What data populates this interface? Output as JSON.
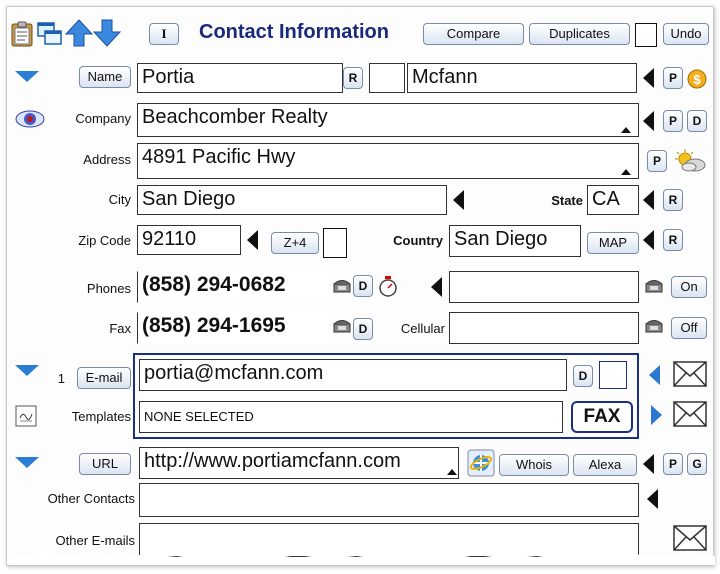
{
  "header": {
    "title": "Contact Information",
    "i_label": "I",
    "compare_label": "Compare",
    "duplicates_label": "Duplicates",
    "undo_label": "Undo"
  },
  "name": {
    "button_label": "Name",
    "first": "Portia",
    "r_label": "R",
    "middle": "",
    "last": "Mcfann",
    "p_label": "P"
  },
  "company": {
    "label": "Company",
    "value": "Beachcomber Realty",
    "p_label": "P",
    "d_label": "D"
  },
  "address": {
    "label": "Address",
    "value": "4891 Pacific Hwy",
    "p_label": "P"
  },
  "city": {
    "label": "City",
    "value": "San Diego",
    "state_label": "State",
    "state_value": "CA",
    "r_label": "R"
  },
  "zip": {
    "label": "Zip Code",
    "value": "92110",
    "z4_label": "Z+4",
    "country_label": "Country",
    "country_value": "San Diego",
    "map_label": "MAP",
    "r_label": "R"
  },
  "phones": {
    "label": "Phones",
    "value": "(858) 294-0682",
    "d_label": "D",
    "right_value": "",
    "on_label": "On"
  },
  "fax": {
    "label": "Fax",
    "value": "(858) 294-1695",
    "d_label": "D",
    "cellular_label": "Cellular",
    "cellular_value": "",
    "off_label": "Off"
  },
  "email": {
    "index": "1",
    "button_label": "E-mail",
    "value": "portia@mcfann.com",
    "d_label": "D"
  },
  "templates": {
    "label": "Templates",
    "value": "NONE SELECTED",
    "fax_label": "FAX"
  },
  "url": {
    "button_label": "URL",
    "value": "http://www.portiamcfann.com",
    "whois_label": "Whois",
    "alexa_label": "Alexa",
    "p_label": "P",
    "g_label": "G"
  },
  "other_contacts": {
    "label": "Other Contacts",
    "value": ""
  },
  "other_emails": {
    "label": "Other E-mails",
    "value": ""
  },
  "colors": {
    "title": "#1a2a7a",
    "accent_blue": "#2a7fd4",
    "border_dark_blue": "#1c2f86"
  }
}
